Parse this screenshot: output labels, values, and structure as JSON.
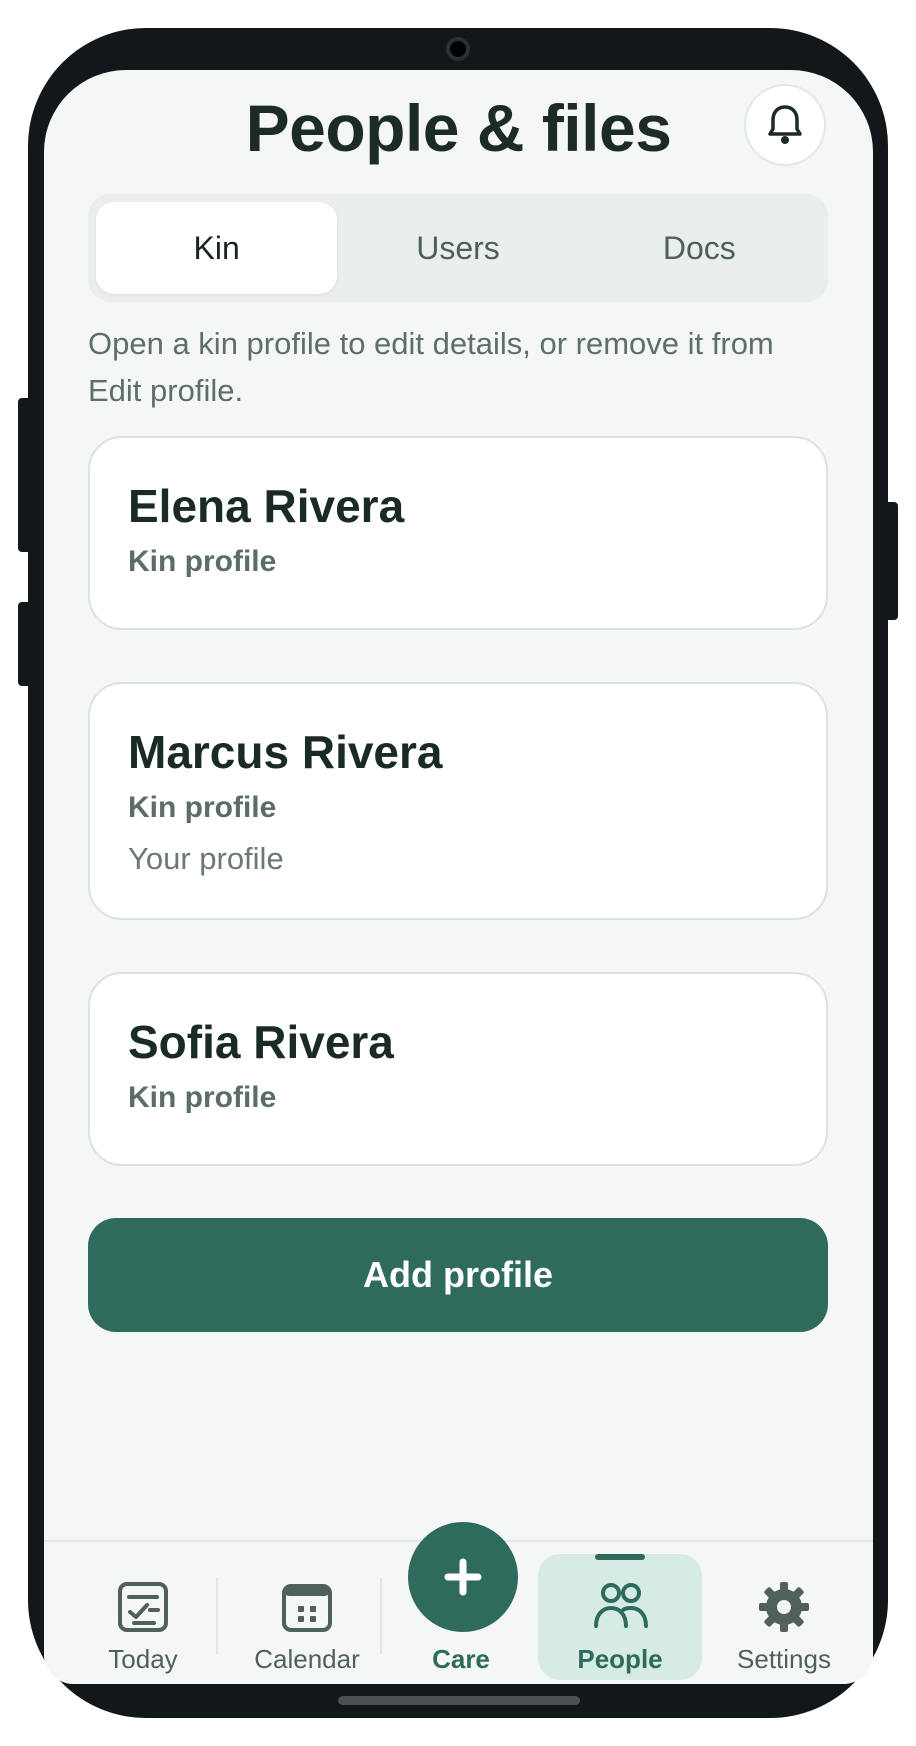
{
  "header": {
    "title": "People & files",
    "notification_icon": "bell-icon"
  },
  "tabs": [
    {
      "label": "Kin",
      "active": true
    },
    {
      "label": "Users",
      "active": false
    },
    {
      "label": "Docs",
      "active": false
    }
  ],
  "hint": "Open a kin profile to edit details, or remove it from Edit profile.",
  "profiles": [
    {
      "name": "Elena Rivera",
      "type": "Kin profile",
      "note": ""
    },
    {
      "name": "Marcus Rivera",
      "type": "Kin profile",
      "note": "Your profile"
    },
    {
      "name": "Sofia Rivera",
      "type": "Kin profile",
      "note": ""
    }
  ],
  "add_button": "Add profile",
  "nav": {
    "today": "Today",
    "calendar": "Calendar",
    "care": "Care",
    "people": "People",
    "settings": "Settings",
    "active": "people"
  },
  "colors": {
    "accent": "#2f6b5c",
    "background": "#f4f7f6",
    "active_nav_bg": "#d6ebe4"
  }
}
